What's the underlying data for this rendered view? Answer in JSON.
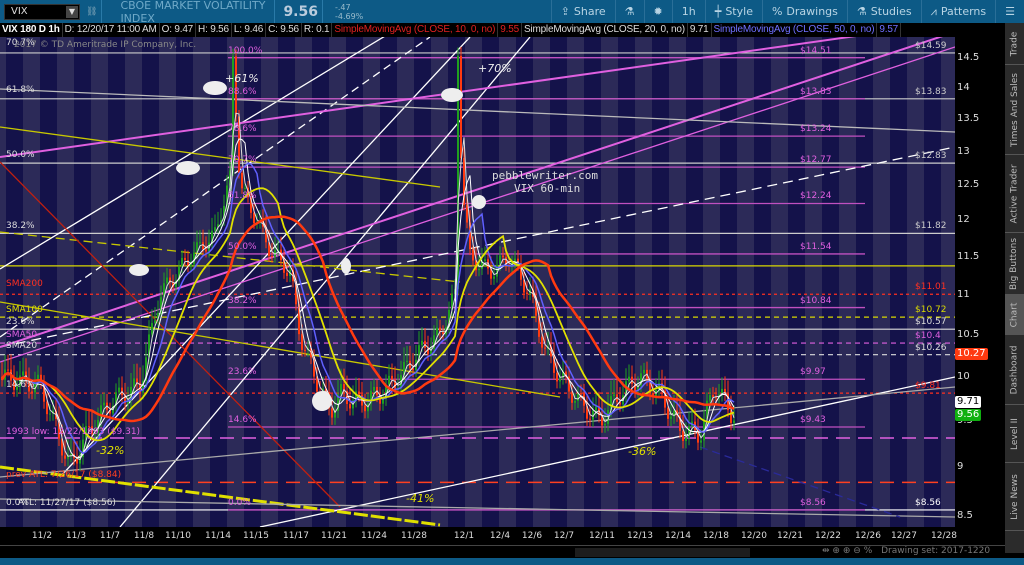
{
  "toolbar": {
    "symbol": "VIX",
    "description": "CBOE MARKET VOLATILITY INDEX",
    "last": "9.56",
    "change": "-.47",
    "change_pct": "-4.69%",
    "buttons": {
      "share": "Share",
      "interval": "1h",
      "style": "Style",
      "drawings": "Drawings",
      "studies": "Studies",
      "patterns": "Patterns"
    }
  },
  "infobar": {
    "title": "VIX 180 D 1h",
    "date": "D: 12/20/17 11:00 AM",
    "open": "O: 9.47",
    "high": "H: 9.56",
    "low": "L: 9.46",
    "close": "C: 9.56",
    "range": "R: 0.1",
    "sma10": "SimpleMovingAvg (CLOSE, 10, 0, no)",
    "sma10_val": "9.55",
    "sma20": "SimpleMovingAvg (CLOSE, 20, 0, no)",
    "sma20_val": "9.71",
    "sma50": "SimpleMovingAvg (CLOSE, 50, 0, no)",
    "sma50_val": "9.57"
  },
  "copyright": "2017 © TD Ameritrade IP Company, Inc.",
  "watermark": {
    "line1": "pebblewriter.com",
    "line2": "VIX 60-min"
  },
  "annotations": [
    "+61%",
    "+70%",
    "-32%",
    "-36%",
    "-41%"
  ],
  "left_labels": [
    "70.7%",
    "61.8%",
    "50.0%",
    "38.2%",
    "SMA200",
    "SMA100",
    "23.6%",
    "SMA50",
    "SMA20",
    "14.6%",
    "1993 low: 12/22/1993 ($9.31)",
    "prev ATL: 7/26/17 ($8.84)",
    "0.0%",
    "ATL: 11/27/17 ($8.56)"
  ],
  "fib_labels": [
    "100.0%",
    "88.6%",
    "78.6%",
    "70.7%",
    "61.8%",
    "50.0%",
    "38.2%",
    "23.6%",
    "14.6%",
    "0.0%"
  ],
  "fib_prices": [
    "$14.51",
    "$13.83",
    "$13.24",
    "$12.77",
    "$12.24",
    "$11.54",
    "$10.84",
    "$9.97",
    "$9.43",
    "$8.56"
  ],
  "levels": [
    {
      "price": 14.59,
      "label": "$14.59",
      "color": "#cccccc",
      "style": "solid"
    },
    {
      "price": 13.83,
      "label": "$13.83",
      "color": "#cccccc",
      "style": "solid"
    },
    {
      "price": 12.83,
      "label": "$12.83",
      "color": "#cccccc",
      "style": "solid"
    },
    {
      "price": 11.82,
      "label": "$11.82",
      "color": "#cccccc",
      "style": "solid"
    },
    {
      "price": 11.38,
      "label": "",
      "color": "#d8d800",
      "style": "solid"
    },
    {
      "price": 11.01,
      "label": "$11.01",
      "color": "#ff3020",
      "style": "dotted"
    },
    {
      "price": 10.72,
      "label": "$10.72",
      "color": "#d8d800",
      "style": "dashed"
    },
    {
      "price": 10.57,
      "label": "$10.57",
      "color": "#dddddd",
      "style": "solid"
    },
    {
      "price": 10.4,
      "label": "$10.4",
      "color": "#e060e0",
      "style": "dashed"
    },
    {
      "price": 10.26,
      "label": "$10.26",
      "color": "#dddddd",
      "style": "dashed"
    },
    {
      "price": 9.81,
      "label": "$9.81",
      "color": "#ff3020",
      "style": "dotted"
    },
    {
      "price": 9.31,
      "label": "",
      "color": "#e060e0",
      "style": "longdash"
    },
    {
      "price": 8.84,
      "label": "",
      "color": "#ff4020",
      "style": "longdash"
    },
    {
      "price": 8.56,
      "label": "$8.56",
      "color": "#ffffff",
      "style": "solid"
    }
  ],
  "fib_levels": [
    14.51,
    13.83,
    13.24,
    12.77,
    12.24,
    11.54,
    10.84,
    9.97,
    9.43,
    8.56
  ],
  "price_axis": {
    "ticks": [
      "14.5",
      "14",
      "13.5",
      "13",
      "12.5",
      "12",
      "11.5",
      "11",
      "10.5",
      "10",
      "9.5",
      "9",
      "8.5"
    ],
    "tick_values": [
      14.5,
      14,
      13.5,
      13,
      12.5,
      12,
      11.5,
      11,
      10.5,
      10,
      9.5,
      9,
      8.5
    ],
    "tags": [
      {
        "value": "10.27",
        "color": "#ff3a10"
      },
      {
        "value": "9.71",
        "color": "#ffffff"
      },
      {
        "value": "9.56",
        "color": "#10b010"
      }
    ]
  },
  "dates": [
    "11/2",
    "11/3",
    "11/7",
    "11/8",
    "11/10",
    "11/14",
    "11/15",
    "11/17",
    "11/21",
    "11/24",
    "11/28",
    "12/1",
    "12/4",
    "12/6",
    "12/7",
    "12/11",
    "12/13",
    "12/14",
    "12/18",
    "12/20",
    "12/21",
    "12/22",
    "12/26",
    "12/27",
    "12/28"
  ],
  "price_path": [
    [
      0,
      10.0
    ],
    [
      40,
      9.9
    ],
    [
      60,
      9.3
    ],
    [
      70,
      9.0
    ],
    [
      90,
      9.4
    ],
    [
      110,
      9.7
    ],
    [
      140,
      9.9
    ],
    [
      160,
      11.0
    ],
    [
      190,
      11.5
    ],
    [
      215,
      11.8
    ],
    [
      230,
      12.6
    ],
    [
      233,
      14.5
    ],
    [
      240,
      12.5
    ],
    [
      250,
      12.2
    ],
    [
      270,
      11.6
    ],
    [
      290,
      11.3
    ],
    [
      300,
      10.5
    ],
    [
      315,
      10.0
    ],
    [
      330,
      9.6
    ],
    [
      340,
      9.8
    ],
    [
      360,
      9.7
    ],
    [
      380,
      9.8
    ],
    [
      400,
      10.0
    ],
    [
      420,
      10.3
    ],
    [
      440,
      10.5
    ],
    [
      455,
      11.0
    ],
    [
      458,
      14.6
    ],
    [
      462,
      12.5
    ],
    [
      470,
      11.5
    ],
    [
      490,
      11.3
    ],
    [
      510,
      11.5
    ],
    [
      530,
      11.0
    ],
    [
      545,
      10.3
    ],
    [
      560,
      10.0
    ],
    [
      580,
      9.7
    ],
    [
      600,
      9.5
    ],
    [
      620,
      9.8
    ],
    [
      640,
      10.0
    ],
    [
      660,
      9.8
    ],
    [
      680,
      9.4
    ],
    [
      700,
      9.35
    ],
    [
      715,
      9.9
    ],
    [
      730,
      9.6
    ],
    [
      735,
      9.56
    ]
  ],
  "side_tabs": [
    "Trade",
    "Times And Sales",
    "Active Trader",
    "Big Buttons",
    "Chart",
    "Dashboard",
    "Level II",
    "Live News"
  ],
  "drawing_set": "Drawing set: 2017-1220",
  "colors": {
    "up": "#1fa01f",
    "down": "#ff3a10",
    "sma10": "#dddddd",
    "sma20": "#ffffff",
    "sma50": "#6060ff",
    "sma100": "#e0e000",
    "sma200": "#ff3a10"
  }
}
